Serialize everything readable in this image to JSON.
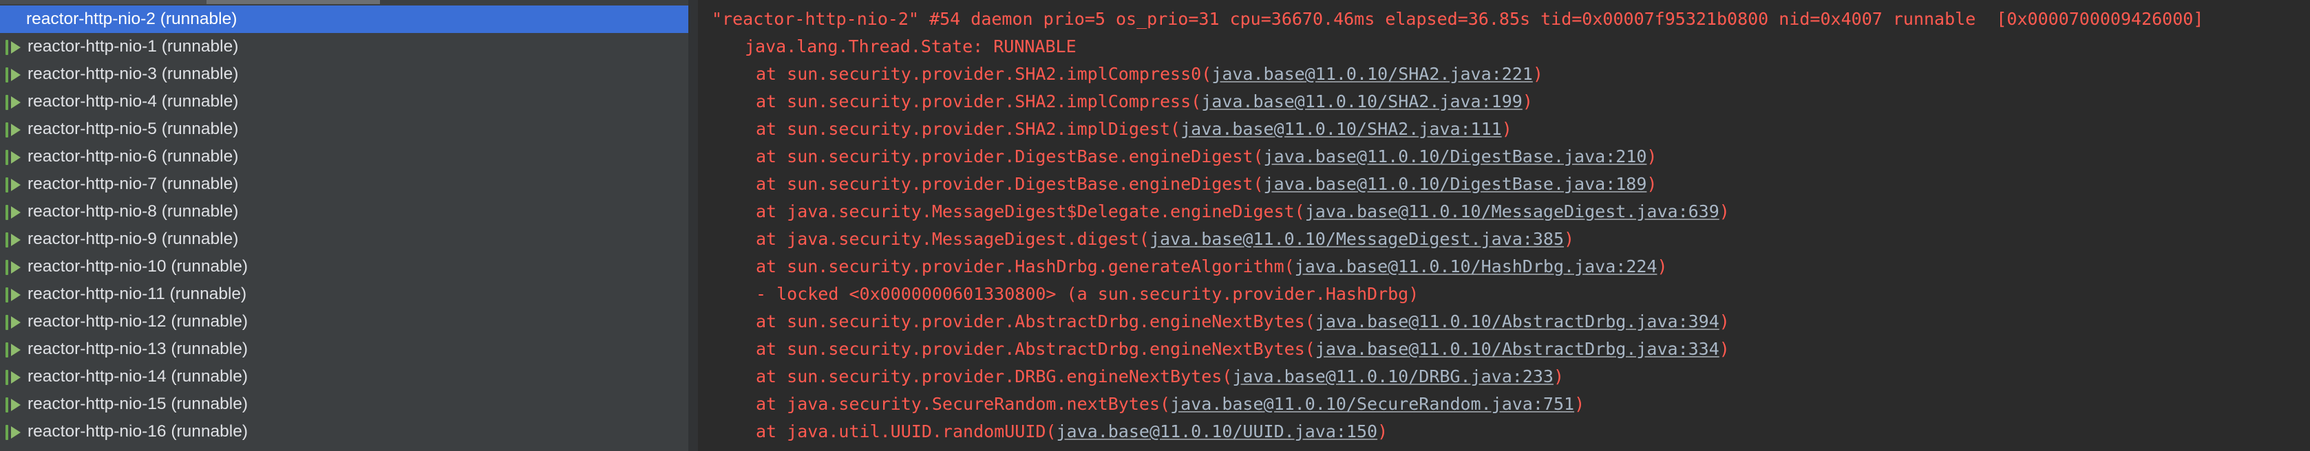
{
  "threads": [
    {
      "label": "reactor-http-nio-2 (runnable)",
      "selected": true
    },
    {
      "label": "reactor-http-nio-1 (runnable)"
    },
    {
      "label": "reactor-http-nio-3 (runnable)"
    },
    {
      "label": "reactor-http-nio-4 (runnable)"
    },
    {
      "label": "reactor-http-nio-5 (runnable)"
    },
    {
      "label": "reactor-http-nio-6 (runnable)"
    },
    {
      "label": "reactor-http-nio-7 (runnable)"
    },
    {
      "label": "reactor-http-nio-8 (runnable)"
    },
    {
      "label": "reactor-http-nio-9 (runnable)"
    },
    {
      "label": "reactor-http-nio-10 (runnable)"
    },
    {
      "label": "reactor-http-nio-11 (runnable)"
    },
    {
      "label": "reactor-http-nio-12 (runnable)"
    },
    {
      "label": "reactor-http-nio-13 (runnable)"
    },
    {
      "label": "reactor-http-nio-14 (runnable)"
    },
    {
      "label": "reactor-http-nio-15 (runnable)"
    },
    {
      "label": "reactor-http-nio-16 (runnable)"
    }
  ],
  "thread_icon": "running-thread-icon",
  "stack": {
    "header": "\"reactor-http-nio-2\" #54 daemon prio=5 os_prio=31 cpu=36670.46ms elapsed=36.85s tid=0x00007f95321b0800 nid=0x4007 runnable  [0x0000700009426000]",
    "state": "java.lang.Thread.State: RUNNABLE",
    "frames": [
      {
        "pre": "at sun.security.provider.SHA2.implCompress0(",
        "loc": "java.base@11.0.10/SHA2.java:221",
        "post": ")"
      },
      {
        "pre": "at sun.security.provider.SHA2.implCompress(",
        "loc": "java.base@11.0.10/SHA2.java:199",
        "post": ")"
      },
      {
        "pre": "at sun.security.provider.SHA2.implDigest(",
        "loc": "java.base@11.0.10/SHA2.java:111",
        "post": ")"
      },
      {
        "pre": "at sun.security.provider.DigestBase.engineDigest(",
        "loc": "java.base@11.0.10/DigestBase.java:210",
        "post": ")"
      },
      {
        "pre": "at sun.security.provider.DigestBase.engineDigest(",
        "loc": "java.base@11.0.10/DigestBase.java:189",
        "post": ")"
      },
      {
        "pre": "at java.security.MessageDigest$Delegate.engineDigest(",
        "loc": "java.base@11.0.10/MessageDigest.java:639",
        "post": ")"
      },
      {
        "pre": "at java.security.MessageDigest.digest(",
        "loc": "java.base@11.0.10/MessageDigest.java:385",
        "post": ")"
      },
      {
        "pre": "at sun.security.provider.HashDrbg.generateAlgorithm(",
        "loc": "java.base@11.0.10/HashDrbg.java:224",
        "post": ")"
      },
      {
        "pre": "- locked <0x0000000601330800> (a sun.security.provider.HashDrbg)",
        "loc": "",
        "post": ""
      },
      {
        "pre": "at sun.security.provider.AbstractDrbg.engineNextBytes(",
        "loc": "java.base@11.0.10/AbstractDrbg.java:394",
        "post": ")"
      },
      {
        "pre": "at sun.security.provider.AbstractDrbg.engineNextBytes(",
        "loc": "java.base@11.0.10/AbstractDrbg.java:334",
        "post": ")"
      },
      {
        "pre": "at sun.security.provider.DRBG.engineNextBytes(",
        "loc": "java.base@11.0.10/DRBG.java:233",
        "post": ")"
      },
      {
        "pre": "at java.security.SecureRandom.nextBytes(",
        "loc": "java.base@11.0.10/SecureRandom.java:751",
        "post": ")"
      },
      {
        "pre": "at java.util.UUID.randomUUID(",
        "loc": "java.base@11.0.10/UUID.java:150",
        "post": ")"
      }
    ]
  },
  "colors": {
    "selected_row": "#3b6fd6",
    "stack_text": "#ff5a50",
    "link_text": "#a9b7c6",
    "panel_bg": "#3c3f41",
    "editor_bg": "#2b2b2b"
  }
}
